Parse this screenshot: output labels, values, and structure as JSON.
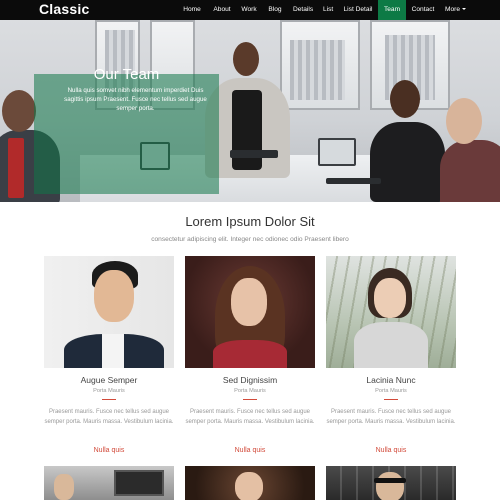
{
  "brand": "Classic",
  "nav": {
    "items": [
      "Home",
      "About",
      "Work",
      "Blog",
      "Details",
      "List",
      "List Detail",
      "Team",
      "Contact",
      "More"
    ],
    "active": "Team",
    "accent": "#0d7a45"
  },
  "hero": {
    "title": "Our Team",
    "text": "Nulla quis somvet nibh elementum imperdiet Duis sagittis ipsum Praesent. Fusce nec tellus sed augue semper porta."
  },
  "section": {
    "title": "Lorem Ipsum Dolor Sit",
    "subtitle": "consectetur adipiscing elit. Integer nec odionec odio Praesent libero"
  },
  "cards": [
    {
      "name": "Augue Semper",
      "role": "Porta Mauris",
      "desc": "Praesent mauris. Fusce nec tellus sed augue semper porta. Mauris massa. Vestibulum lacinia.",
      "link": "Nulla quis"
    },
    {
      "name": "Sed Dignissim",
      "role": "Porta Mauris",
      "desc": "Praesent mauris. Fusce nec tellus sed augue semper porta. Mauris massa. Vestibulum lacinia.",
      "link": "Nulla quis"
    },
    {
      "name": "Lacinia Nunc",
      "role": "Porta Mauris",
      "desc": "Praesent mauris. Fusce nec tellus sed augue semper porta. Mauris massa. Vestibulum lacinia.",
      "link": "Nulla quis"
    }
  ],
  "colors": {
    "accent_red": "#d24a3a",
    "navbar": "#0b0b0b"
  }
}
